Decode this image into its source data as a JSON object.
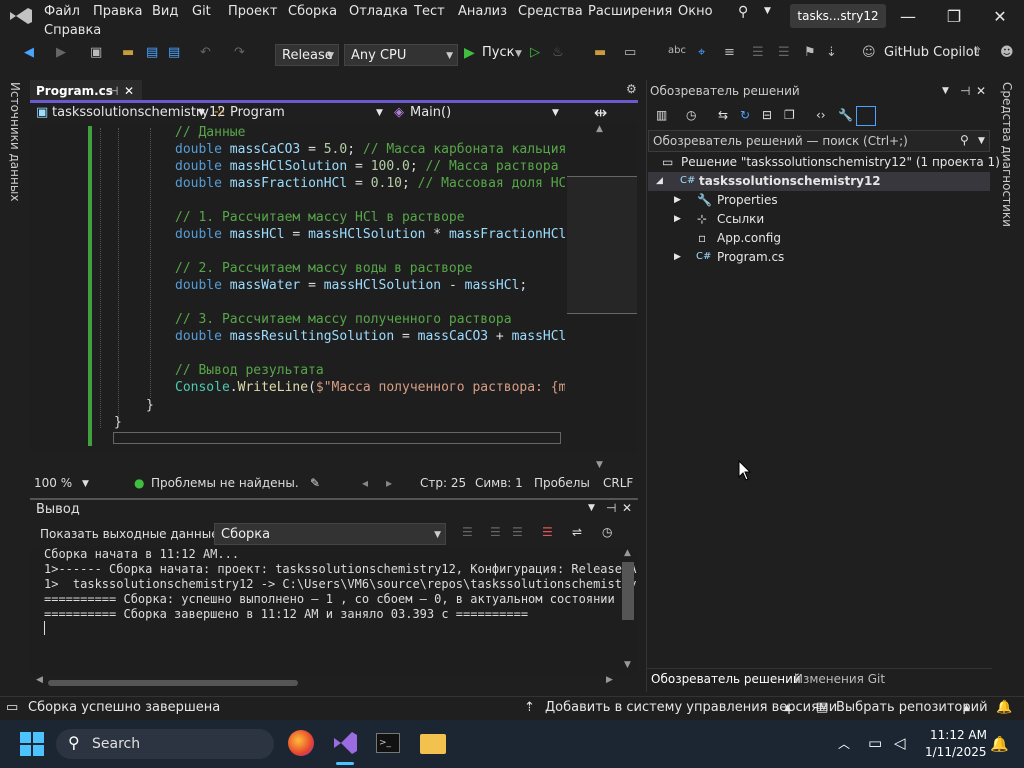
{
  "menu": [
    "Файл",
    "Правка",
    "Вид",
    "Git",
    "Проект",
    "Сборка",
    "Отладка",
    "Тест",
    "Анализ",
    "Средства",
    "Расширения",
    "Окно",
    "Справка"
  ],
  "solution_short": "tasks...stry12",
  "toolbar": {
    "config": "Release",
    "platform": "Any CPU",
    "run": "Пуск",
    "copilot": "GitHub Copilot"
  },
  "side_left": "Источники данных",
  "side_right": "Средства диагностики",
  "editor": {
    "tab": "Program.cs",
    "nav_project": "taskssolutionschemistry12",
    "nav_class": "Program",
    "nav_method": "Main()",
    "code": [
      {
        "t": "cm",
        "s": "// Данные"
      },
      {
        "t": "decl",
        "v": "massCaCO3",
        "e": " = ",
        "n": "5.0",
        "c": "; // Масса карбоната кальция"
      },
      {
        "t": "decl",
        "v": "massHClSolution",
        "e": " = ",
        "n": "100.0",
        "c": "; // Масса раствора Н"
      },
      {
        "t": "decl",
        "v": "massFractionHCl",
        "e": " = ",
        "n": "0.10",
        "c": "; // Массовая доля HCl"
      },
      {
        "t": "blank"
      },
      {
        "t": "cm",
        "s": "// 1. Рассчитаем массу HCl в растворе"
      },
      {
        "t": "expr",
        "s": "double massHCl = massHClSolution * massFractionHCl;"
      },
      {
        "t": "blank"
      },
      {
        "t": "cm",
        "s": "// 2. Рассчитаем массу воды в растворе"
      },
      {
        "t": "expr",
        "s": "double massWater = massHClSolution - massHCl;"
      },
      {
        "t": "blank"
      },
      {
        "t": "cm",
        "s": "// 3. Рассчитаем массу полученного раствора"
      },
      {
        "t": "expr",
        "s": "double massResultingSolution = massCaCO3 + massHCl"
      },
      {
        "t": "blank"
      },
      {
        "t": "cm",
        "s": "// Вывод результата"
      },
      {
        "t": "console",
        "s": "Console.WriteLine($\"Масса полученного раствора: {ma"
      }
    ],
    "kw_double": "double",
    "brace1": "}",
    "brace2": "}"
  },
  "editor_status": {
    "zoom": "100 %",
    "issues": "Проблемы не найдены.",
    "line": "Стр: 25",
    "col": "Симв: 1",
    "spaces": "Пробелы",
    "eol": "CRLF"
  },
  "output": {
    "title": "Вывод",
    "show_label": "Показать выходные данные из:",
    "source": "Сборка",
    "lines": [
      "Сборка начата в 11:12 AM...",
      "1>------ Сборка начата: проект: taskssolutionschemistry12, Конфигурация: Release A",
      "1>  taskssolutionschemistry12 -> C:\\Users\\VM6\\source\\repos\\taskssolutionschemistry",
      "========== Сборка: успешно выполнено — 1 , со сбоем — 0, в актуальном состоянии —",
      "========== Сборка завершено в 11:12 AM и заняло 03.393 с =========="
    ]
  },
  "solution_explorer": {
    "title": "Обозреватель решений",
    "search": "Обозреватель решений — поиск (Ctrl+;)",
    "solution": "Решение \"taskssolutionschemistry12\" (1 проекта 1)",
    "project": "taskssolutionschemistry12",
    "items": [
      "Properties",
      "Ссылки",
      "App.config",
      "Program.cs"
    ],
    "bottom_tabs": [
      "Обозреватель решений",
      "Изменения Git"
    ]
  },
  "status": {
    "left": "Сборка успешно завершена",
    "vcs": "Добавить в систему управления версиями",
    "repo": "Выбрать репозиторий"
  },
  "taskbar": {
    "search": "Search",
    "time": "11:12 AM",
    "date": "1/11/2025"
  }
}
